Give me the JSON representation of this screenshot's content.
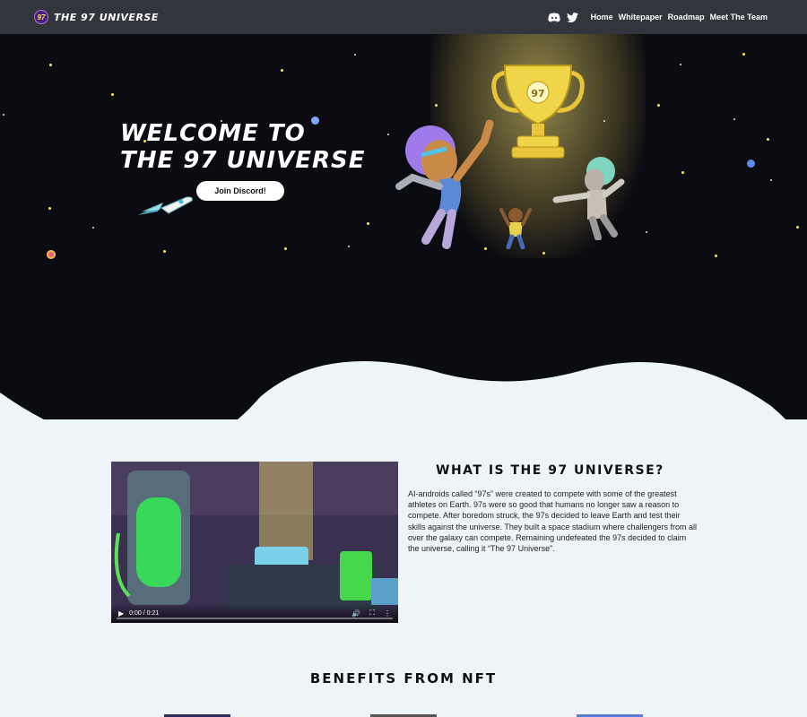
{
  "nav": {
    "logo_badge": "97",
    "logo_text": "THE 97 UNIVERSE",
    "icons": [
      "discord-icon",
      "twitter-icon"
    ],
    "links": [
      "Home",
      "Whitepaper",
      "Roadmap",
      "Meet The Team"
    ]
  },
  "hero": {
    "title_line1": "WELCOME TO",
    "title_line2": "THE 97 UNIVERSE",
    "button_label": "Join Discord!",
    "trophy_label": "97"
  },
  "about": {
    "title": "WHAT IS THE 97 UNIVERSE?",
    "body": "AI-androids called “97s” were created to compete with some of the greatest athletes on Earth. 97s were so good that humans no longer saw a reason to compete. After boredom struck, the 97s decided to leave Earth and test their skills against the universe. They built a space stadium where challengers from all over the galaxy can compete. Remaining undefeated the 97s decided to claim the universe, calling it “The 97 Universe”.",
    "video_time": "0:00 / 0:21"
  },
  "benefits": {
    "title": "BENEFITS FROM NFT"
  },
  "colors": {
    "nav_bg": "#33353d",
    "hero_bg": "#0b0c12",
    "page_bg": "#eef5f8",
    "accent_yellow": "#ffe14a"
  }
}
